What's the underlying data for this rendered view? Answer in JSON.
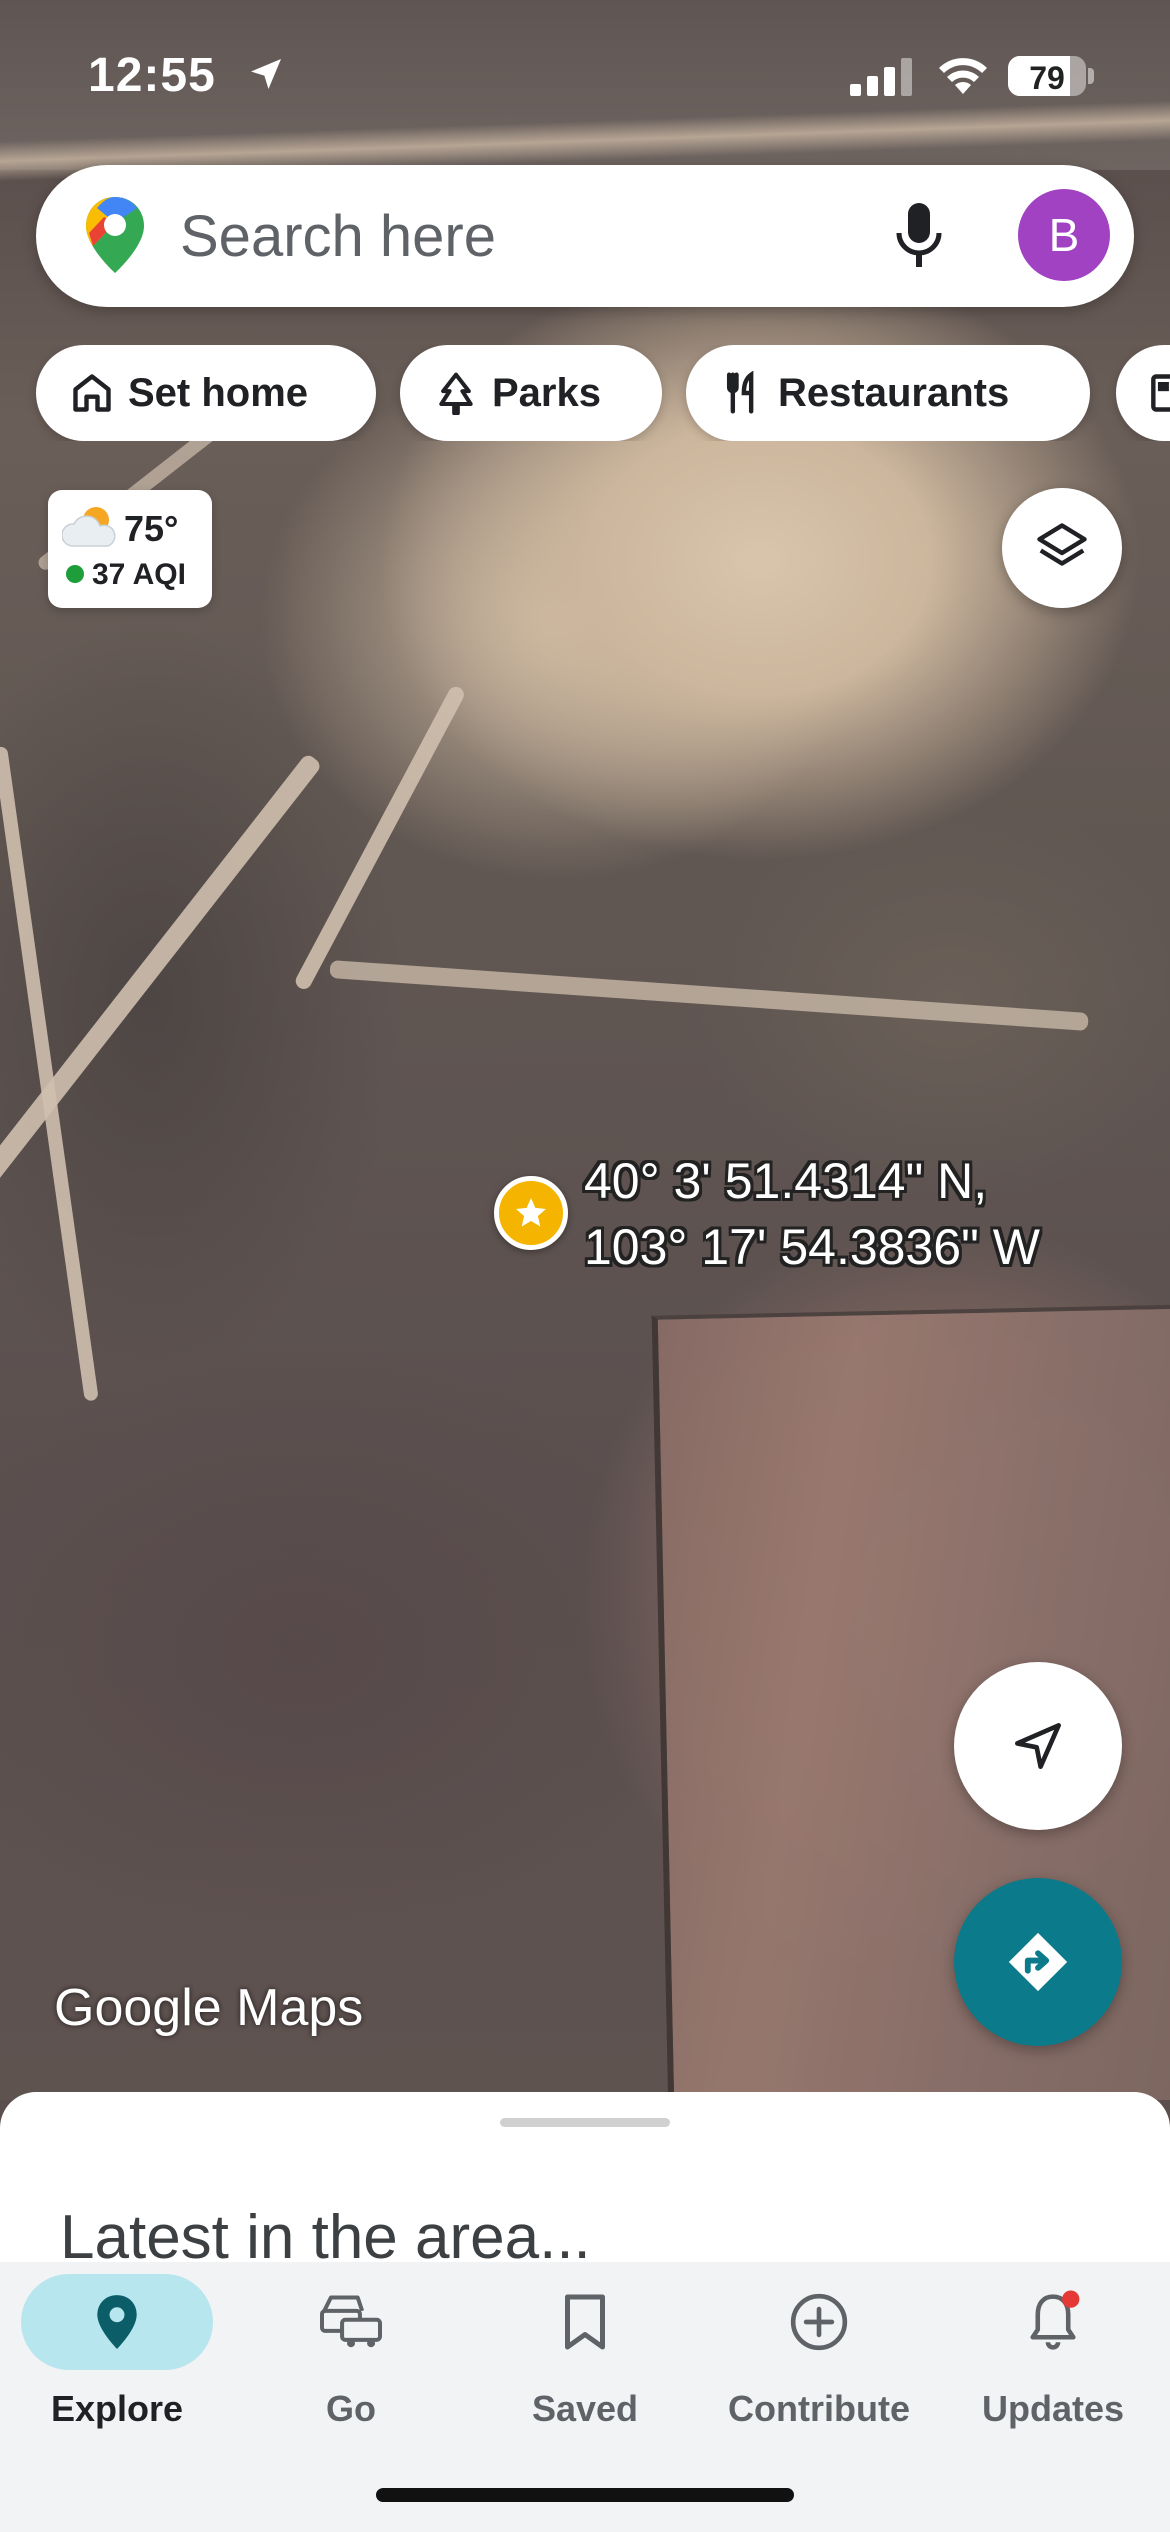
{
  "status_bar": {
    "time": "12:55",
    "battery": "79",
    "battery_level_percent": 79
  },
  "search": {
    "placeholder": "Search here",
    "avatar_letter": "B",
    "avatar_color": "#a142c3"
  },
  "chips": [
    {
      "label": "Set home",
      "icon": "home-icon"
    },
    {
      "label": "Parks",
      "icon": "tree-icon"
    },
    {
      "label": "Restaurants",
      "icon": "fork-knife-icon"
    },
    {
      "label": "",
      "icon": "gas-station-icon"
    }
  ],
  "weather": {
    "temperature": "75°",
    "aqi": "37 AQI",
    "aqi_color": "#1e9e3a"
  },
  "dropped_pin": {
    "latitude": "40° 3' 51.4314\" N,",
    "longitude": "103° 17' 54.3836\" W",
    "marker_color": "#f4b400"
  },
  "map": {
    "logo_text": "Google Maps"
  },
  "bottom_sheet": {
    "title": "Latest in the area..."
  },
  "nav": {
    "items": [
      {
        "label": "Explore",
        "icon": "location-pin-icon",
        "active": true
      },
      {
        "label": "Go",
        "icon": "car-icon",
        "active": false
      },
      {
        "label": "Saved",
        "icon": "bookmark-icon",
        "active": false
      },
      {
        "label": "Contribute",
        "icon": "plus-circle-icon",
        "active": false
      },
      {
        "label": "Updates",
        "icon": "bell-icon",
        "active": false
      }
    ]
  },
  "colors": {
    "accent": "#0b7a8a",
    "active_nav_bg": "#b8e6ee",
    "notification_dot": "#e53935"
  }
}
